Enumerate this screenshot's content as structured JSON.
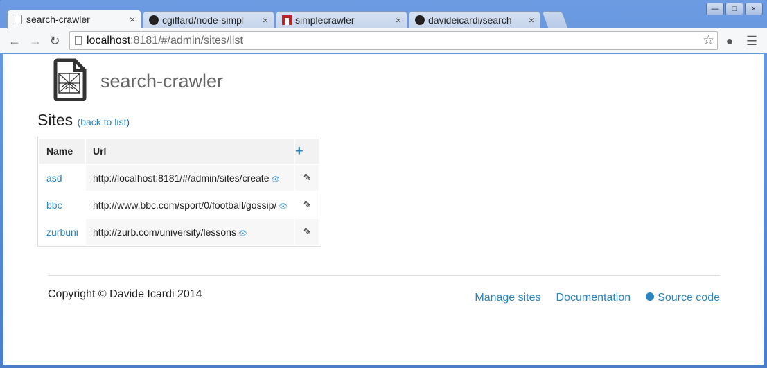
{
  "browser": {
    "tabs": [
      {
        "title": "search-crawler",
        "icon": "document-icon",
        "active": true
      },
      {
        "title": "cgiffard/node-simpl",
        "icon": "github-icon",
        "active": false
      },
      {
        "title": "simplecrawler",
        "icon": "npm-icon",
        "active": false
      },
      {
        "title": "davideicardi/search",
        "icon": "github-icon",
        "active": false
      }
    ],
    "close_glyph": "×",
    "address": {
      "host": "localhost",
      "path": ":8181/#/admin/sites/list"
    },
    "window_controls": {
      "minimize": "—",
      "maximize": "□",
      "close": "×"
    }
  },
  "page": {
    "brand": "search-crawler",
    "heading": "Sites",
    "back_prefix": "(",
    "back_link": "back to list",
    "back_suffix": ")",
    "table": {
      "columns": [
        "Name",
        "Url"
      ],
      "rows": [
        {
          "name": "asd",
          "url": "http://localhost:8181/#/admin/sites/create"
        },
        {
          "name": "bbc",
          "url": "http://www.bbc.com/sport/0/football/gossip/"
        },
        {
          "name": "zurbuni",
          "url": "http://zurb.com/university/lessons"
        }
      ]
    },
    "footer": {
      "copyright": "Copyright © Davide Icardi 2014",
      "links": [
        "Manage sites",
        "Documentation",
        "Source code"
      ]
    }
  },
  "colors": {
    "accent": "#2b84bf",
    "chrome": "#5d8bd4"
  }
}
